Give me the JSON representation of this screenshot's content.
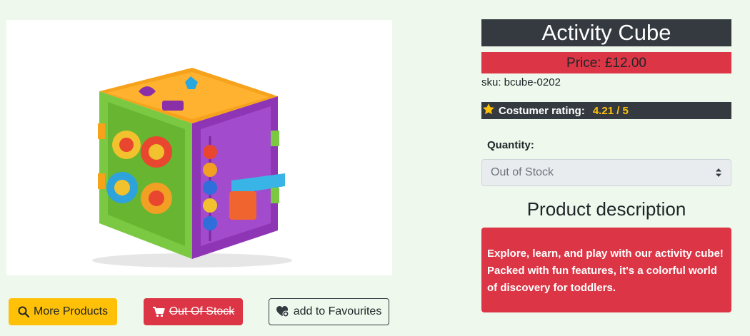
{
  "product": {
    "title": "Activity Cube",
    "price": "Price: £12.00",
    "sku": "sku: bcube-0202",
    "rating_label": "Costumer rating:",
    "rating_value": "4.21 / 5",
    "image_alt": "Activity Cube"
  },
  "quantity": {
    "label": "Quantity:",
    "selected": "Out of Stock"
  },
  "description": {
    "heading": "Product description",
    "text": "Explore, learn, and play with our activity cube! Packed with fun features, it's a colorful world of discovery for toddlers."
  },
  "actions": {
    "more_products": "More Products",
    "out_of_stock": "Out Of Stock",
    "add_favourites": "add to Favourites"
  },
  "icons": {
    "more_products": "search-icon",
    "out_of_stock": "cart-icon",
    "add_favourites": "heart-plus-icon",
    "rating": "star-icon",
    "select": "sort-caret-icon"
  },
  "colors": {
    "background": "#eef8ec",
    "dark": "#343a40",
    "danger": "#dc3545",
    "warning": "#ffc107"
  }
}
